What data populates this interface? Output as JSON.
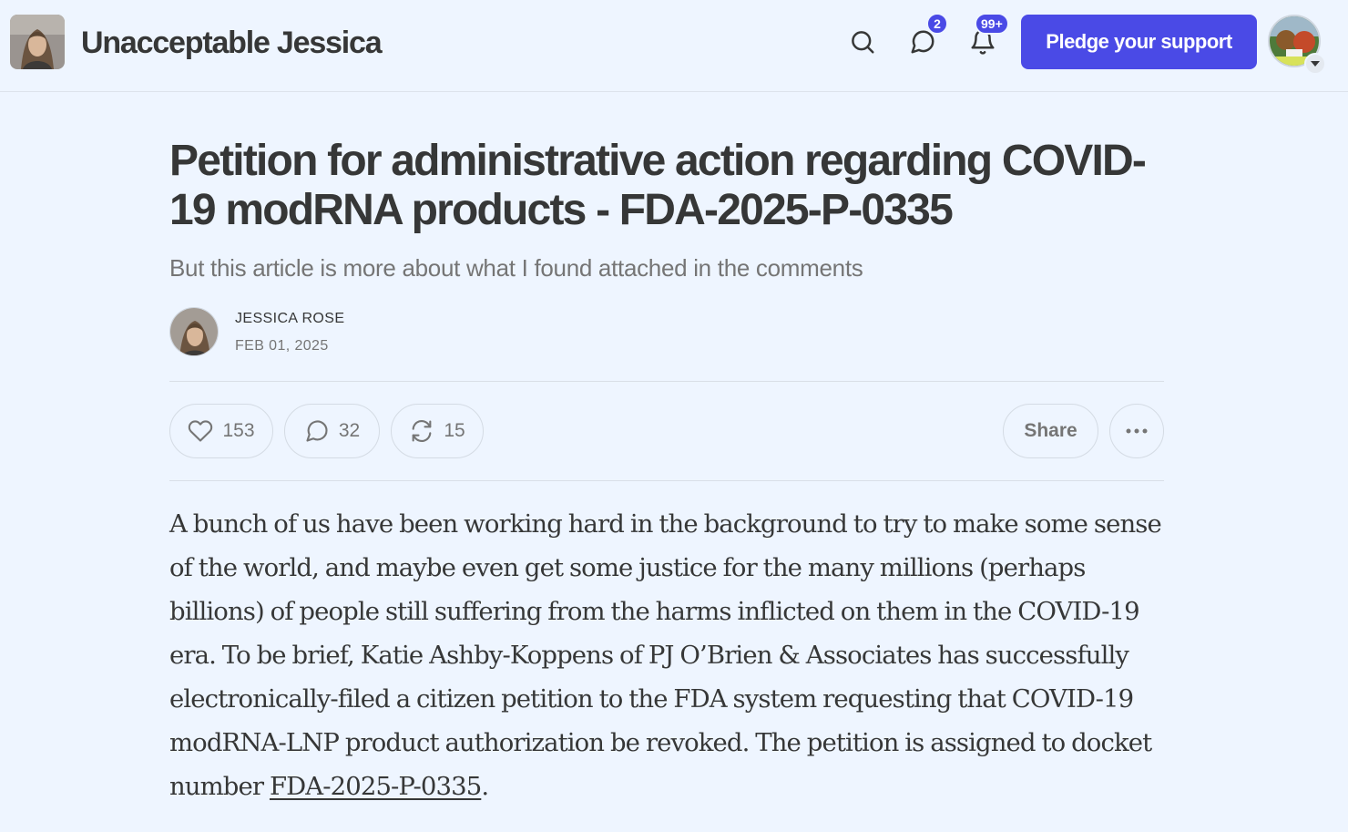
{
  "header": {
    "publication_name": "Unacceptable Jessica",
    "chat_badge": "2",
    "notification_badge": "99+",
    "pledge_label": "Pledge your support"
  },
  "post": {
    "title": "Petition for administrative action regarding COVID-19 modRNA products - FDA-2025-P-0335",
    "subtitle": "But this article is more about what I found attached in the comments",
    "author": "JESSICA ROSE",
    "date": "FEB 01, 2025",
    "likes": "153",
    "comments": "32",
    "restacks": "15",
    "share_label": "Share",
    "body_text": "A bunch of us have been working hard in the background to try to make some sense of the world, and maybe even get some justice for the many millions (perhaps billions) of people still suffering from the harms inflicted on them in the COVID-19 era. To be brief, Katie Ashby-Koppens of PJ O’Brien & Associates has successfully electronically-filed a citizen petition to the FDA system requesting that COVID-19 modRNA-LNP product authorization be revoked. The petition is assigned to docket number ",
    "body_link": "FDA-2025-P-0335",
    "body_end": "."
  },
  "icons": [
    "search-icon",
    "chat-icon",
    "bell-icon",
    "heart-icon",
    "comment-icon",
    "restack-icon",
    "more-icon",
    "chevron-down-icon"
  ],
  "colors": {
    "accent": "#4a4ae6",
    "background": "#eef5ff",
    "text": "#363737",
    "muted": "#757575"
  }
}
